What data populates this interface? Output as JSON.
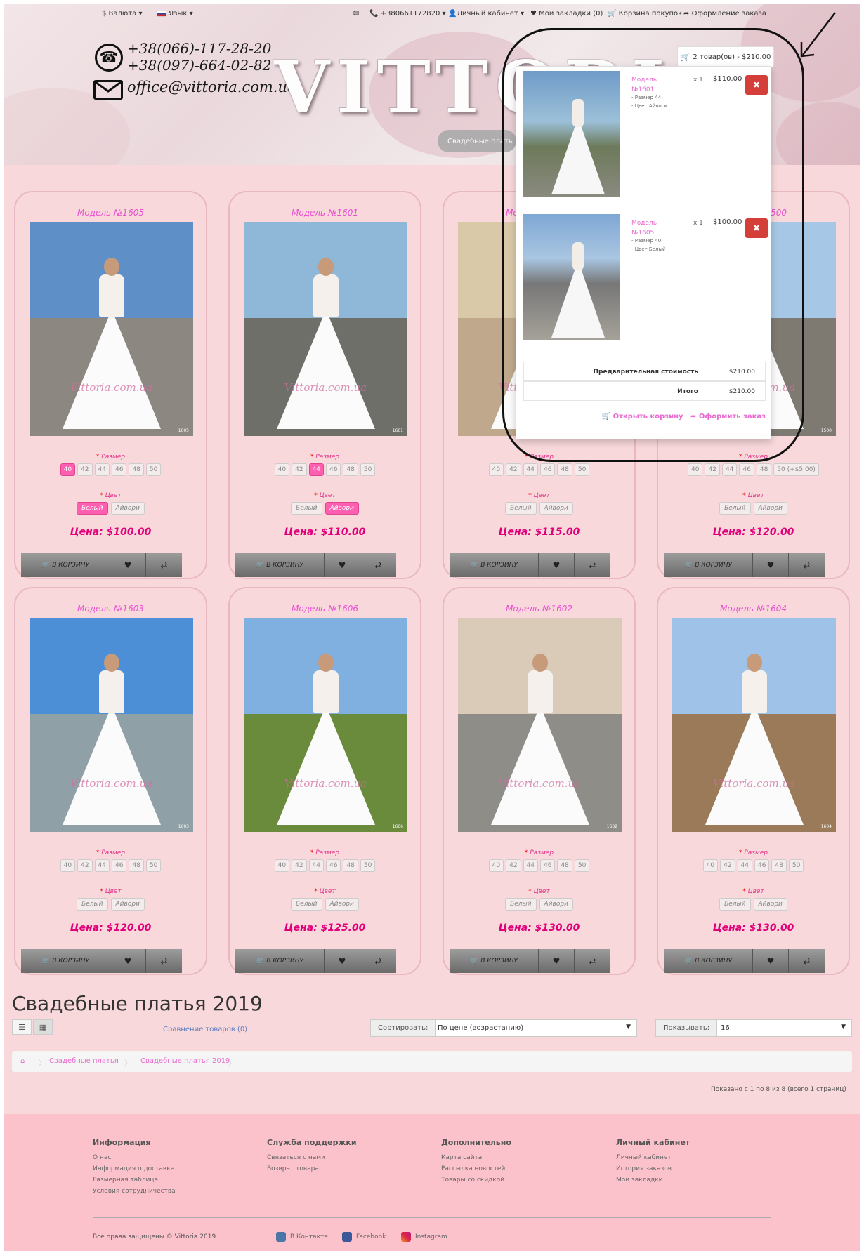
{
  "topbar": {
    "currency": "$ Валюта",
    "language": "Язык",
    "phone": "+380661172820",
    "account": "Личный кабинет",
    "wishlist": "Мои закладки (0)",
    "cart": "Корзина покупок",
    "checkout": "Оформление заказа"
  },
  "header": {
    "phone1": "+38(066)-117-28-20",
    "phone2": "+38(097)-664-02-82",
    "email": "office@vittoria.com.ua",
    "logo": "VITTORIA",
    "cart_button": "2 товар(ов) - $210.00",
    "menu_item": "Свадебные плать"
  },
  "products": [
    {
      "title": "Модель №1605",
      "price": "Цена: $100.00",
      "num": "1605",
      "sizes": [
        "40",
        "42",
        "44",
        "46",
        "48",
        "50"
      ],
      "selected_size": "40",
      "colors": [
        "Белый",
        "Айвори"
      ],
      "selected_color": "Белый"
    },
    {
      "title": "Модель №1601",
      "price": "Цена: $110.00",
      "num": "1601",
      "sizes": [
        "40",
        "42",
        "44",
        "46",
        "48",
        "50"
      ],
      "selected_size": "44",
      "colors": [
        "Белый",
        "Айвори"
      ],
      "selected_color": "Айвори"
    },
    {
      "title": "Модель №1600",
      "price": "Цена: $115.00",
      "num": "1600",
      "sizes": [
        "40",
        "42",
        "44",
        "46",
        "48",
        "50"
      ],
      "selected_size": "",
      "colors": [
        "Белый",
        "Айвори"
      ],
      "selected_color": ""
    },
    {
      "title": "Модель №1500",
      "price": "Цена: $120.00",
      "num": "1500",
      "sizes": [
        "40",
        "42",
        "44",
        "46",
        "48",
        "50 (+$5.00)"
      ],
      "selected_size": "",
      "colors": [
        "Белый",
        "Айвори"
      ],
      "selected_color": ""
    },
    {
      "title": "Модель №1603",
      "price": "Цена: $120.00",
      "num": "1603",
      "sizes": [
        "40",
        "42",
        "44",
        "46",
        "48",
        "50"
      ],
      "selected_size": "",
      "colors": [
        "Белый",
        "Айвори"
      ],
      "selected_color": ""
    },
    {
      "title": "Модель №1606",
      "price": "Цена: $125.00",
      "num": "1606",
      "sizes": [
        "40",
        "42",
        "44",
        "46",
        "48",
        "50"
      ],
      "selected_size": "",
      "colors": [
        "Белый",
        "Айвори"
      ],
      "selected_color": ""
    },
    {
      "title": "Модель №1602",
      "price": "Цена: $130.00",
      "num": "1602",
      "sizes": [
        "40",
        "42",
        "44",
        "46",
        "48",
        "50"
      ],
      "selected_size": "",
      "colors": [
        "Белый",
        "Айвори"
      ],
      "selected_color": ""
    },
    {
      "title": "Модель №1604",
      "price": "Цена: $130.00",
      "num": "1604",
      "sizes": [
        "40",
        "42",
        "44",
        "46",
        "48",
        "50"
      ],
      "selected_size": "",
      "colors": [
        "Белый",
        "Айвори"
      ],
      "selected_color": ""
    }
  ],
  "labels": {
    "size": "Размер",
    "color": "Цвет",
    "add_to_cart": "В КОРЗИНУ",
    "dots": "..",
    "watermark": "Vittoria.com.ua"
  },
  "cart_dropdown": {
    "items": [
      {
        "name": "Модель №1601",
        "opt1": "- Размер 44",
        "opt2": "- Цвет Айвори",
        "qty": "x 1",
        "price": "$110.00"
      },
      {
        "name": "Модель №1605",
        "opt1": "- Размер 40",
        "opt2": "- Цвет Белый",
        "qty": "x 1",
        "price": "$100.00"
      }
    ],
    "subtotal_label": "Предварительная стоимость",
    "subtotal": "$210.00",
    "total_label": "Итого",
    "total": "$210.00",
    "open_cart": "Открыть корзину",
    "checkout": "Оформить заказ"
  },
  "listing": {
    "title": "Свадебные платья 2019",
    "compare": "Сравнение товаров (0)",
    "sort_label": "Сортировать:",
    "sort_value": "По цене (возрастанию)",
    "show_label": "Показывать:",
    "show_value": "16",
    "breadcrumb": [
      "Свадебные платья",
      "Свадебные платья 2019"
    ],
    "showing": "Показано с 1 по 8 из 8 (всего 1 страниц)"
  },
  "footer": {
    "columns": [
      {
        "title": "Информация",
        "links": [
          "О нас",
          "Информация о доставке",
          "Размерная таблица",
          "Условия сотрудничества"
        ]
      },
      {
        "title": "Служба поддержки",
        "links": [
          "Связаться с нами",
          "Возврат товара"
        ]
      },
      {
        "title": "Дополнительно",
        "links": [
          "Карта сайта",
          "Рассылка новостей",
          "Товары со скидкой"
        ]
      },
      {
        "title": "Личный кабинет",
        "links": [
          "Личный кабинет",
          "История заказов",
          "Мои закладки"
        ]
      }
    ],
    "copyright": "Все права защищены © Vittoria 2019",
    "social": [
      "В Контакте",
      "Facebook",
      "Instagram"
    ]
  },
  "colors": {
    "pink_bg": "#f8d8da",
    "accent": "#e84fd0",
    "price": "#e2007a",
    "footer": "#fcc2cc",
    "delete": "#d43f3a"
  }
}
